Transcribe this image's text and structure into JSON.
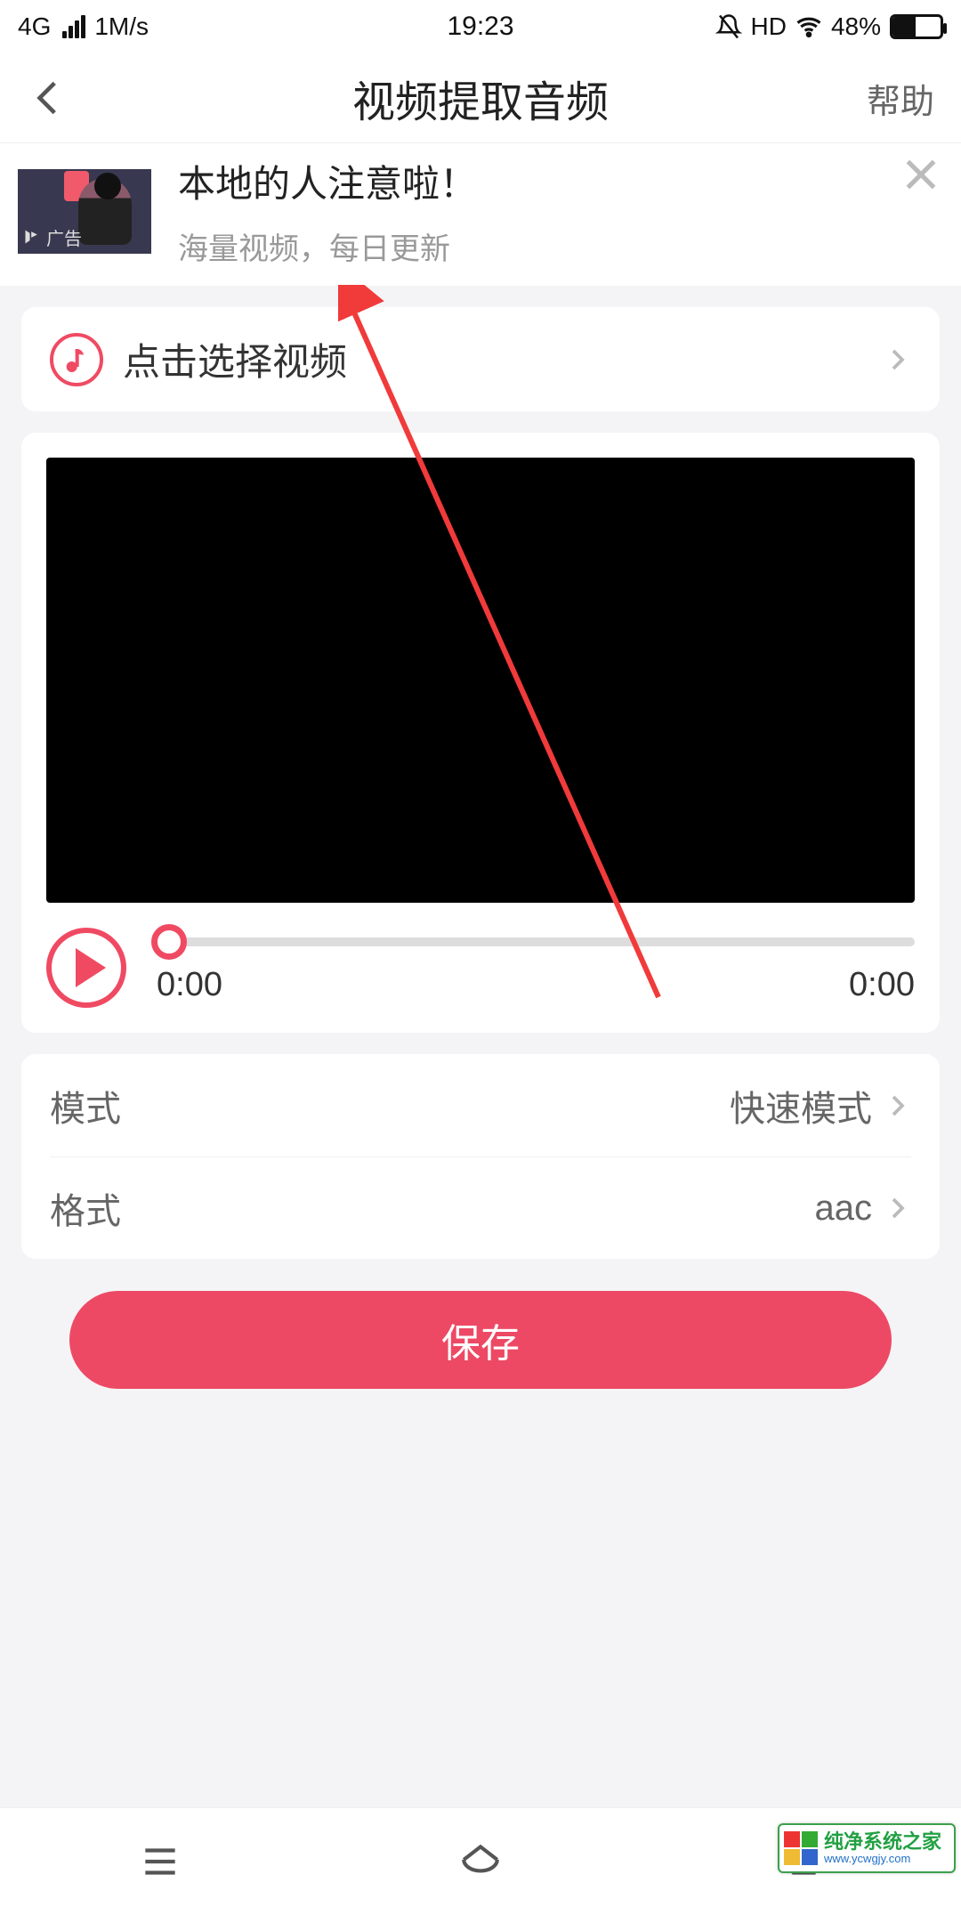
{
  "status": {
    "network": "4G",
    "speed": "1M/s",
    "time": "19:23",
    "hd": "HD",
    "battery_pct": "48%",
    "battery_fill": 48
  },
  "nav": {
    "title": "视频提取音频",
    "help": "帮助"
  },
  "ad": {
    "title": "本地的人注意啦！",
    "subtitle": "海量视频，每日更新",
    "tag": "广告"
  },
  "select": {
    "label": "点击选择视频"
  },
  "player": {
    "current": "0:00",
    "total": "0:00"
  },
  "settings": {
    "mode_label": "模式",
    "mode_value": "快速模式",
    "format_label": "格式",
    "format_value": "aac"
  },
  "action": {
    "save": "保存"
  },
  "watermark": {
    "line1": "纯净系统之家",
    "line2": "www.ycwgjy.com"
  }
}
